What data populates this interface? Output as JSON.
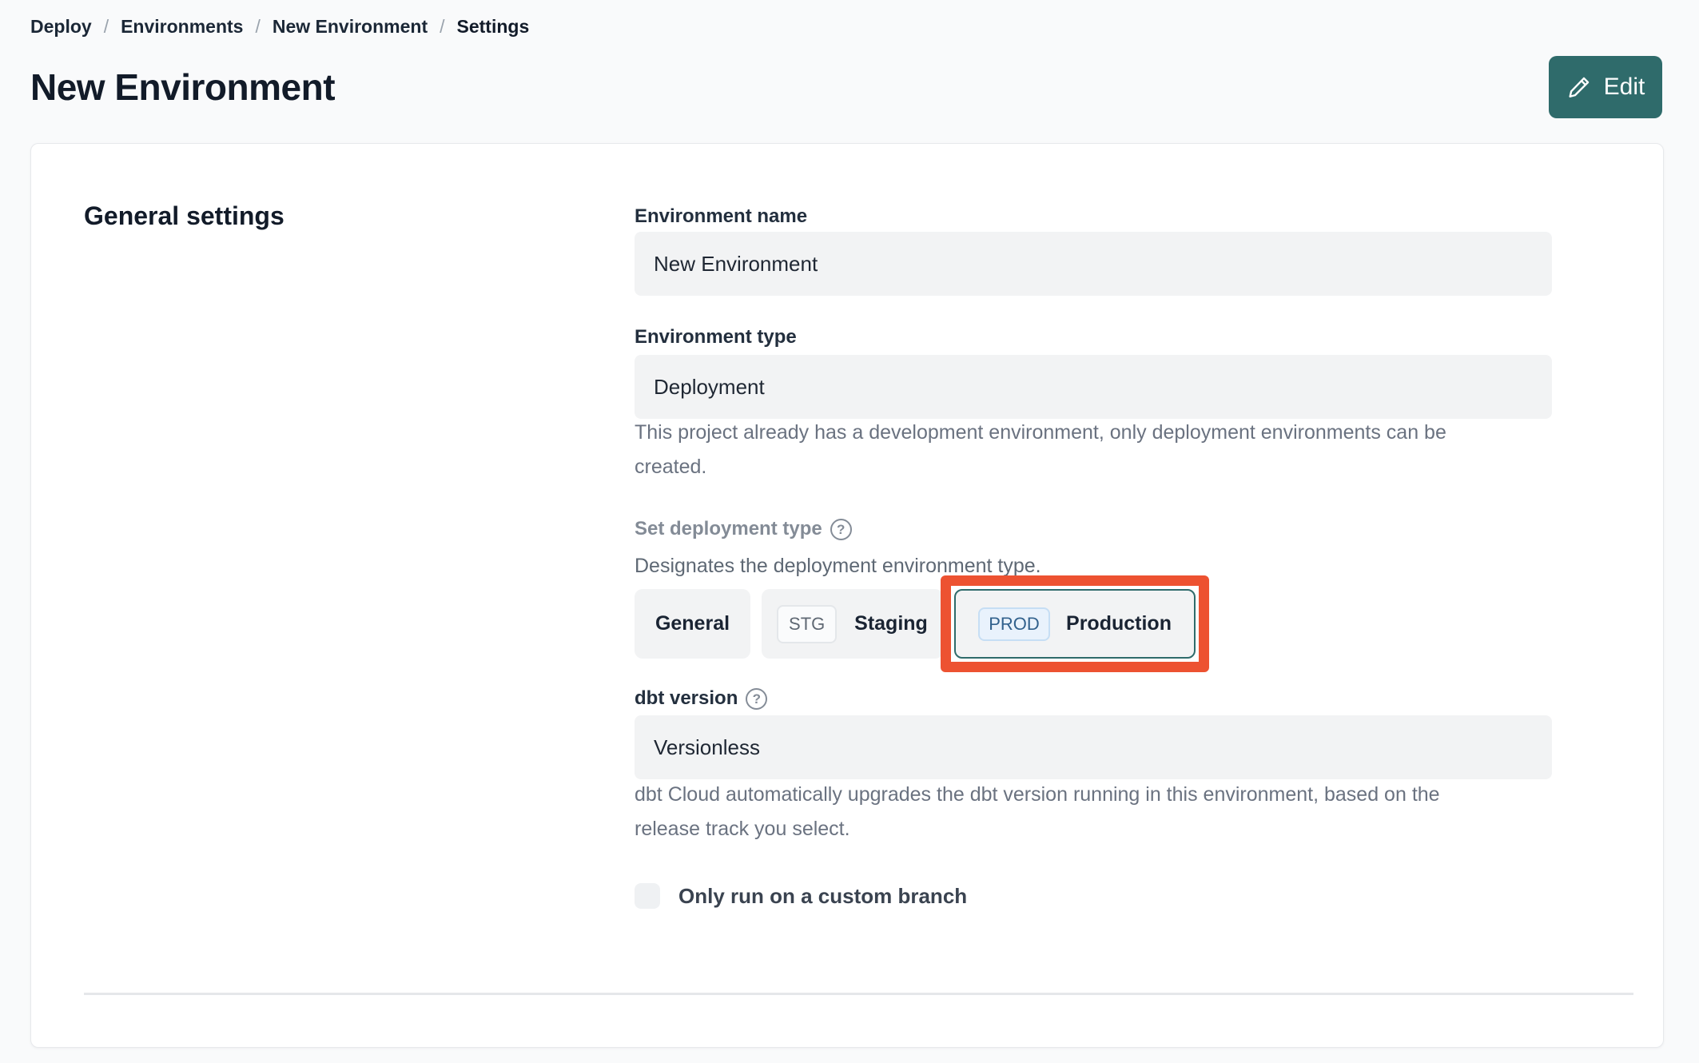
{
  "breadcrumb": {
    "separator": "/",
    "items": [
      {
        "label": "Deploy"
      },
      {
        "label": "Environments"
      },
      {
        "label": "New Environment"
      },
      {
        "label": "Settings"
      }
    ]
  },
  "header": {
    "title": "New Environment",
    "edit_label": "Edit"
  },
  "icons": {
    "edit_button": "pencil-icon",
    "deployment_type_help": "question-circle-icon",
    "dbt_version_help": "question-circle-icon",
    "question_glyph": "?"
  },
  "card": {
    "section_title": "General settings",
    "environment_name": {
      "label": "Environment name",
      "value": "New Environment"
    },
    "environment_type": {
      "label": "Environment type",
      "value": "Deployment",
      "help": "This project already has a development environment, only deployment environments can be created."
    },
    "deployment_type": {
      "label": "Set deployment type",
      "description": "Designates the deployment environment type.",
      "options": [
        {
          "label": "General",
          "tag": "",
          "selected": false
        },
        {
          "label": "Staging",
          "tag": "STG",
          "selected": false
        },
        {
          "label": "Production",
          "tag": "PROD",
          "selected": true,
          "highlighted": true
        }
      ]
    },
    "dbt_version": {
      "label": "dbt version",
      "value": "Versionless",
      "help": "dbt Cloud automatically upgrades the dbt version running in this environment, based on the release track you select."
    },
    "custom_branch": {
      "label": "Only run on a custom branch",
      "checked": false
    }
  },
  "colors": {
    "accent_teal": "#2F6B6B",
    "annotation_orange": "#ED5231",
    "page_background": "#F9FAFB",
    "input_background": "#F2F3F4",
    "prod_badge_background": "#E9F2FC",
    "prod_badge_border": "#C6DEF4",
    "prod_badge_text": "#31618D",
    "helper_text_gray": "#6A7280"
  }
}
